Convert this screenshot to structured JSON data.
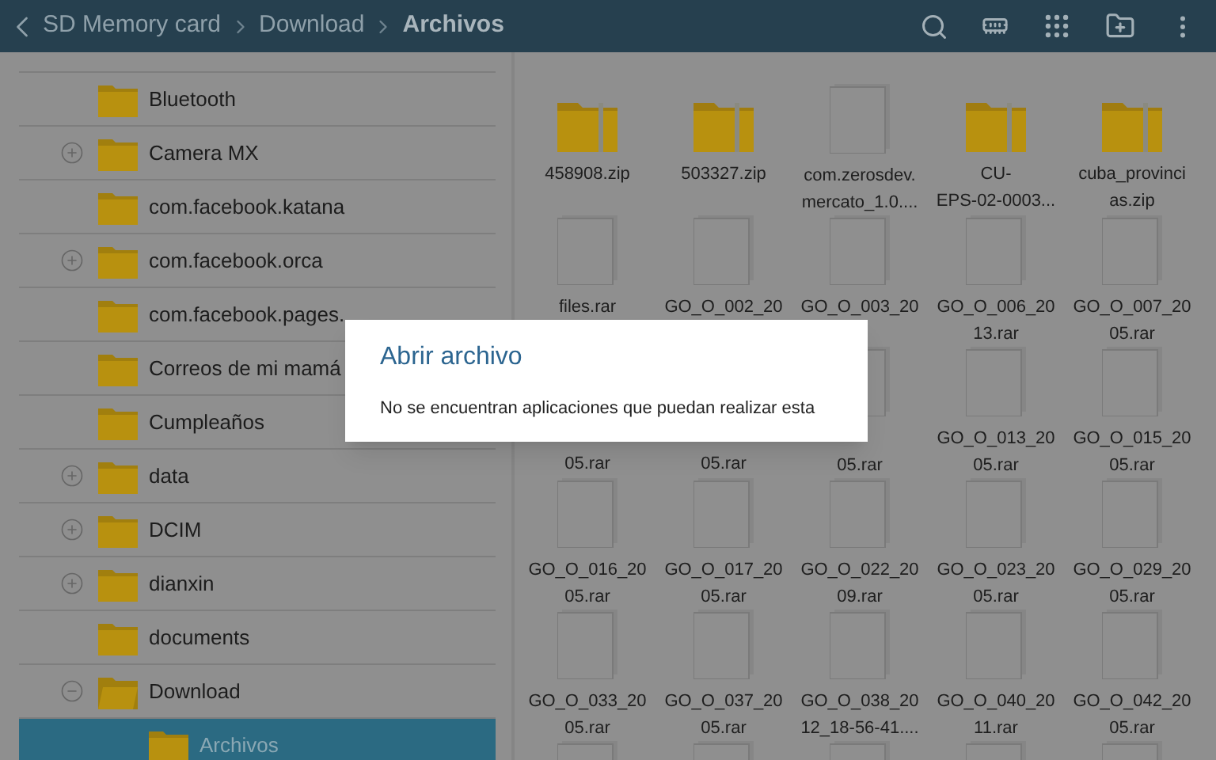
{
  "header": {
    "breadcrumbs": [
      {
        "label": "SD Memory card",
        "selected": false
      },
      {
        "label": "Download",
        "selected": false
      },
      {
        "label": "Archivos",
        "selected": true
      }
    ]
  },
  "tree": [
    {
      "name": "Bluetooth",
      "kind": "folder",
      "selected": false
    },
    {
      "name": "Camera MX",
      "kind": "expandable",
      "expanded": false,
      "selected": false
    },
    {
      "name": "com.facebook.katana",
      "kind": "folder",
      "selected": false
    },
    {
      "name": "com.facebook.orca",
      "kind": "expandable",
      "expanded": false,
      "selected": false
    },
    {
      "name": "com.facebook.pages.",
      "kind": "folder",
      "selected": false
    },
    {
      "name": "Correos de mi mamá",
      "kind": "folder",
      "selected": false
    },
    {
      "name": "Cumpleaños",
      "kind": "folder",
      "selected": false
    },
    {
      "name": "data",
      "kind": "expandable",
      "expanded": false,
      "selected": false
    },
    {
      "name": "DCIM",
      "kind": "expandable",
      "expanded": false,
      "selected": false
    },
    {
      "name": "dianxin",
      "kind": "expandable",
      "expanded": false,
      "selected": false
    },
    {
      "name": "documents",
      "kind": "folder",
      "selected": false
    },
    {
      "name": "Download",
      "kind": "expandable",
      "expanded": true,
      "selected": false,
      "children": [
        {
          "name": "Archivos",
          "kind": "folder",
          "selected": true
        }
      ]
    }
  ],
  "file_rows": [
    {
      "items": [
        {
          "kind": "zip",
          "lines": [
            "458908.zip"
          ]
        },
        {
          "kind": "zip",
          "lines": [
            "503327.zip"
          ]
        },
        {
          "kind": "file",
          "lines": [
            "com.zerosdev.",
            "mercato_1.0...."
          ]
        },
        {
          "kind": "zip",
          "lines": [
            "CU-",
            "EPS-02-0003..."
          ]
        },
        {
          "kind": "zip",
          "lines": [
            "cuba_provinci",
            "as.zip"
          ]
        }
      ]
    },
    {
      "items": [
        {
          "kind": "file",
          "lines": [
            "files.rar"
          ]
        },
        {
          "kind": "file",
          "lines": [
            "GO_O_002_20"
          ]
        },
        {
          "kind": "file",
          "lines": [
            "GO_O_003_20"
          ]
        },
        {
          "kind": "file",
          "lines": [
            "GO_O_006_20",
            "13.rar"
          ]
        },
        {
          "kind": "file",
          "lines": [
            "GO_O_007_20",
            "05.rar"
          ]
        }
      ]
    },
    {
      "items": [
        {
          "kind": "label",
          "covered": true,
          "lines": [
            "05.rar"
          ]
        },
        {
          "kind": "label",
          "covered": true,
          "lines": [
            "05.rar"
          ]
        },
        {
          "kind": "file",
          "covered": true,
          "lines": [
            "05.rar"
          ]
        },
        {
          "kind": "file",
          "lines": [
            "GO_O_013_20",
            "05.rar"
          ]
        },
        {
          "kind": "file",
          "lines": [
            "GO_O_015_20",
            "05.rar"
          ]
        }
      ]
    },
    {
      "items": [
        {
          "kind": "file",
          "lines": [
            "GO_O_016_20",
            "05.rar"
          ]
        },
        {
          "kind": "file",
          "lines": [
            "GO_O_017_20",
            "05.rar"
          ]
        },
        {
          "kind": "file",
          "lines": [
            "GO_O_022_20",
            "09.rar"
          ]
        },
        {
          "kind": "file",
          "lines": [
            "GO_O_023_20",
            "05.rar"
          ]
        },
        {
          "kind": "file",
          "lines": [
            "GO_O_029_20",
            "05.rar"
          ]
        }
      ]
    },
    {
      "items": [
        {
          "kind": "file",
          "lines": [
            "GO_O_033_20",
            "05.rar"
          ]
        },
        {
          "kind": "file",
          "lines": [
            "GO_O_037_20",
            "05.rar"
          ]
        },
        {
          "kind": "file",
          "lines": [
            "GO_O_038_20",
            "12_18-56-41...."
          ]
        },
        {
          "kind": "file",
          "lines": [
            "GO_O_040_20",
            "11.rar"
          ]
        },
        {
          "kind": "file",
          "lines": [
            "GO_O_042_20",
            "05.rar"
          ]
        }
      ]
    },
    {
      "items": [
        {
          "kind": "file"
        },
        {
          "kind": "file"
        },
        {
          "kind": "file"
        },
        {
          "kind": "file"
        },
        {
          "kind": "file"
        }
      ]
    }
  ],
  "dialog": {
    "title": "Abrir archivo",
    "message": "No se encuentran aplicaciones que puedan realizar esta"
  }
}
